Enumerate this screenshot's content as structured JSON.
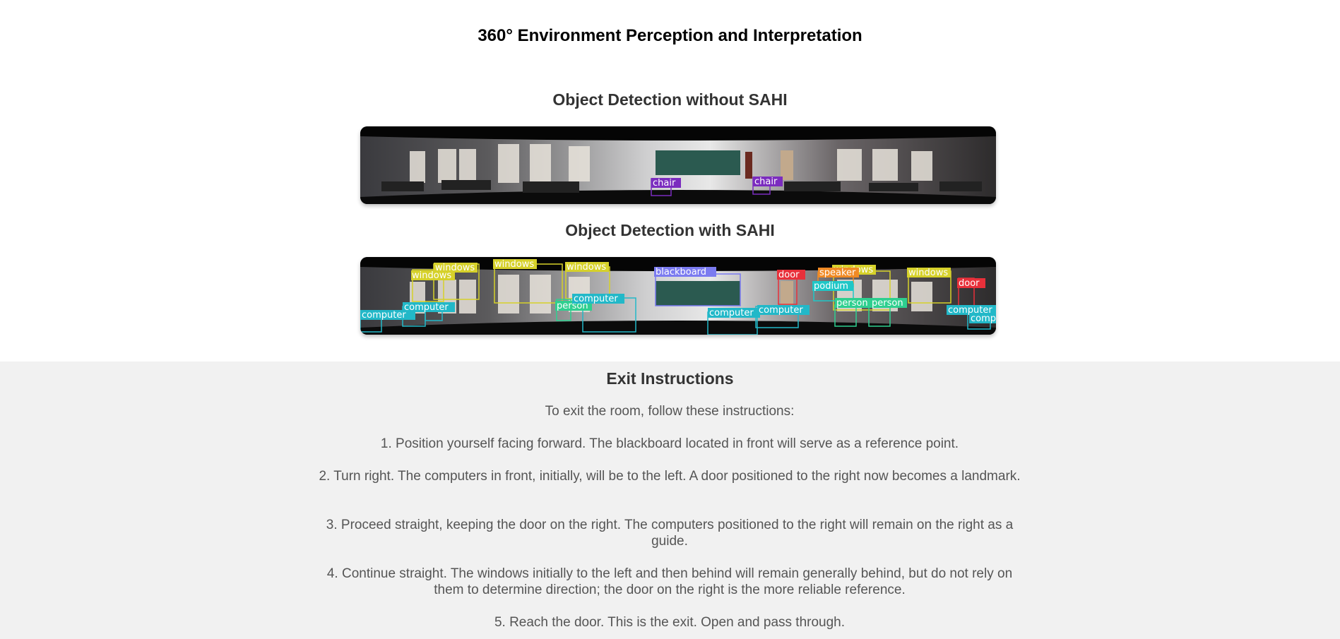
{
  "page": {
    "title": "360° Environment Perception and Interpretation"
  },
  "without_sahi": {
    "title": "Object Detection without SAHI",
    "detections": [
      {
        "label": "chair",
        "color": "#7b2cbf"
      },
      {
        "label": "chair",
        "color": "#7b2cbf"
      }
    ]
  },
  "with_sahi": {
    "title": "Object Detection with SAHI",
    "detections": [
      {
        "label": "windows",
        "color": "#d6d12a"
      },
      {
        "label": "windows",
        "color": "#d6d12a"
      },
      {
        "label": "windows",
        "color": "#d6d12a"
      },
      {
        "label": "windows",
        "color": "#d6d12a"
      },
      {
        "label": "windows",
        "color": "#d6d12a"
      },
      {
        "label": "windows",
        "color": "#d6d12a"
      },
      {
        "label": "blackboard",
        "color": "#7b7bf0"
      },
      {
        "label": "door",
        "color": "#e8303a"
      },
      {
        "label": "door",
        "color": "#e8303a"
      },
      {
        "label": "speaker",
        "color": "#f08a24"
      },
      {
        "label": "podium",
        "color": "#1fc7c7"
      },
      {
        "label": "person",
        "color": "#2ecf8f"
      },
      {
        "label": "person",
        "color": "#2ecf8f"
      },
      {
        "label": "person",
        "color": "#2ecf8f"
      },
      {
        "label": "computer",
        "color": "#22b8c8"
      },
      {
        "label": "computer",
        "color": "#22b8c8"
      },
      {
        "label": "computer",
        "color": "#22b8c8"
      },
      {
        "label": "computer",
        "color": "#22b8c8"
      },
      {
        "label": "computer",
        "color": "#22b8c8"
      },
      {
        "label": "computer",
        "color": "#22b8c8"
      },
      {
        "label": "computer",
        "color": "#22b8c8"
      }
    ]
  },
  "exit": {
    "title": "Exit Instructions",
    "intro": "To exit the room, follow these instructions:",
    "steps": [
      "1. Position yourself facing forward. The blackboard located in front will serve as a reference point.",
      "2. Turn right. The computers in front, initially, will be to the left. A door positioned to the right now becomes a landmark.",
      "3. Proceed straight, keeping the door on the right. The computers positioned to the right will remain on the right as a guide.",
      "4. Continue straight. The windows initially to the left and then behind will remain generally behind, but do not rely on them to determine direction; the door on the right is the more reliable reference.",
      "5. Reach the door. This is the exit. Open and pass through."
    ]
  }
}
